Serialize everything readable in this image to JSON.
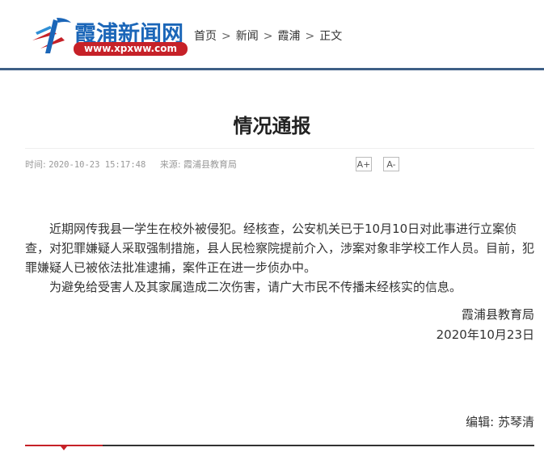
{
  "header": {
    "logo_title": "霞浦新闻网",
    "logo_url": "www.xpxww.com",
    "breadcrumb": [
      "首页",
      "新闻",
      "霞浦",
      "正文"
    ]
  },
  "article": {
    "title": "情况通报",
    "meta": {
      "time_label": "时间:",
      "time": "2020-10-23 15:17:48",
      "source_label": "来源:",
      "source": "霞浦县教育局"
    },
    "font_increase": "A+",
    "font_decrease": "A-",
    "paragraphs": [
      "近期网传我县一学生在校外被侵犯。经核查，公安机关已于10月10日对此事进行立案侦查，对犯罪嫌疑人采取强制措施，县人民检察院提前介入，涉案对象非学校工作人员。目前，犯罪嫌疑人已被依法批准逮捕，案件正在进一步侦办中。",
      "为避免给受害人及其家属造成二次伤害，请广大市民不传播未经核实的信息。"
    ],
    "signature_org": "霞浦县教育局",
    "signature_date": "2020年10月23日",
    "editor": "编辑: 苏琴清"
  },
  "colors": {
    "brand_blue": "#1b66b8",
    "brand_red": "#c62128",
    "header_line": "#3e5f86"
  }
}
